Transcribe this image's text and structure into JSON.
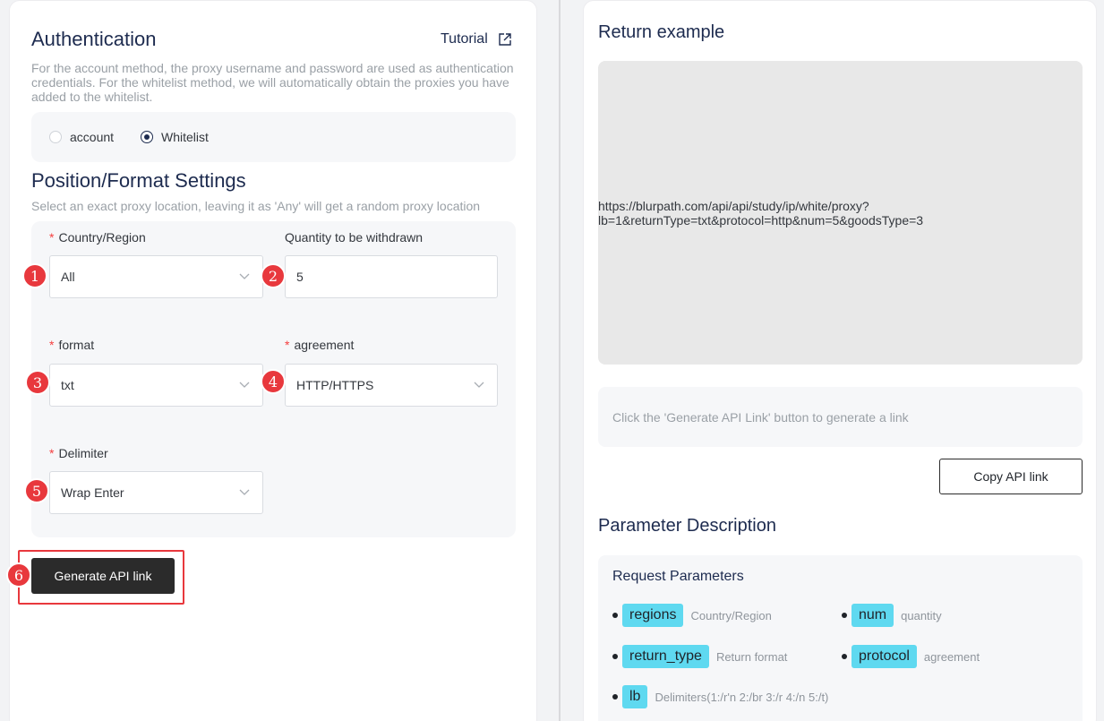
{
  "auth": {
    "title": "Authentication",
    "tutorial_label": "Tutorial",
    "description": "For the account method, the proxy username and password are used as authentication credentials. For the whitelist method, we will automatically obtain the proxies you have added to the whitelist.",
    "options": [
      {
        "label": "account",
        "selected": false
      },
      {
        "label": "Whitelist",
        "selected": true
      }
    ]
  },
  "position": {
    "title": "Position/Format Settings",
    "description": "Select an exact proxy location, leaving it as 'Any' will get a random proxy location",
    "required_mark": "*",
    "fields": {
      "country": {
        "label": "Country/Region",
        "value": "All",
        "badge": "1"
      },
      "quantity": {
        "label": "Quantity to be withdrawn",
        "value": "5",
        "badge": "2"
      },
      "format": {
        "label": "format",
        "value": "txt",
        "badge": "3"
      },
      "agreement": {
        "label": "agreement",
        "value": "HTTP/HTTPS",
        "badge": "4"
      },
      "delimiter": {
        "label": "Delimiter",
        "value": "Wrap Enter",
        "badge": "5"
      }
    }
  },
  "generate": {
    "label": "Generate API link",
    "badge": "6"
  },
  "return_example": {
    "title": "Return example",
    "content": "https://blurpath.com/api/api/study/ip/white/proxy?\nlb=1&returnType=txt&protocol=http&num=5&goodsType=3"
  },
  "link_hint": "Click the 'Generate API Link' button to generate a link",
  "copy_label": "Copy API link",
  "params": {
    "title": "Parameter Description",
    "subtitle": "Request Parameters",
    "items": [
      {
        "name": "regions",
        "desc": "Country/Region"
      },
      {
        "name": "num",
        "desc": "quantity"
      },
      {
        "name": "return_type",
        "desc": "Return format"
      },
      {
        "name": "protocol",
        "desc": "agreement"
      },
      {
        "name": "lb",
        "desc": "Delimiters(1:/r'n 2:/br 3:/r 4:/n 5:/t)"
      }
    ]
  },
  "colors": {
    "accent_navy": "#1d2b4f",
    "badge_red": "#e8383d",
    "tag_cyan": "#5fd9f0",
    "primary_button": "#2b2b2b"
  }
}
